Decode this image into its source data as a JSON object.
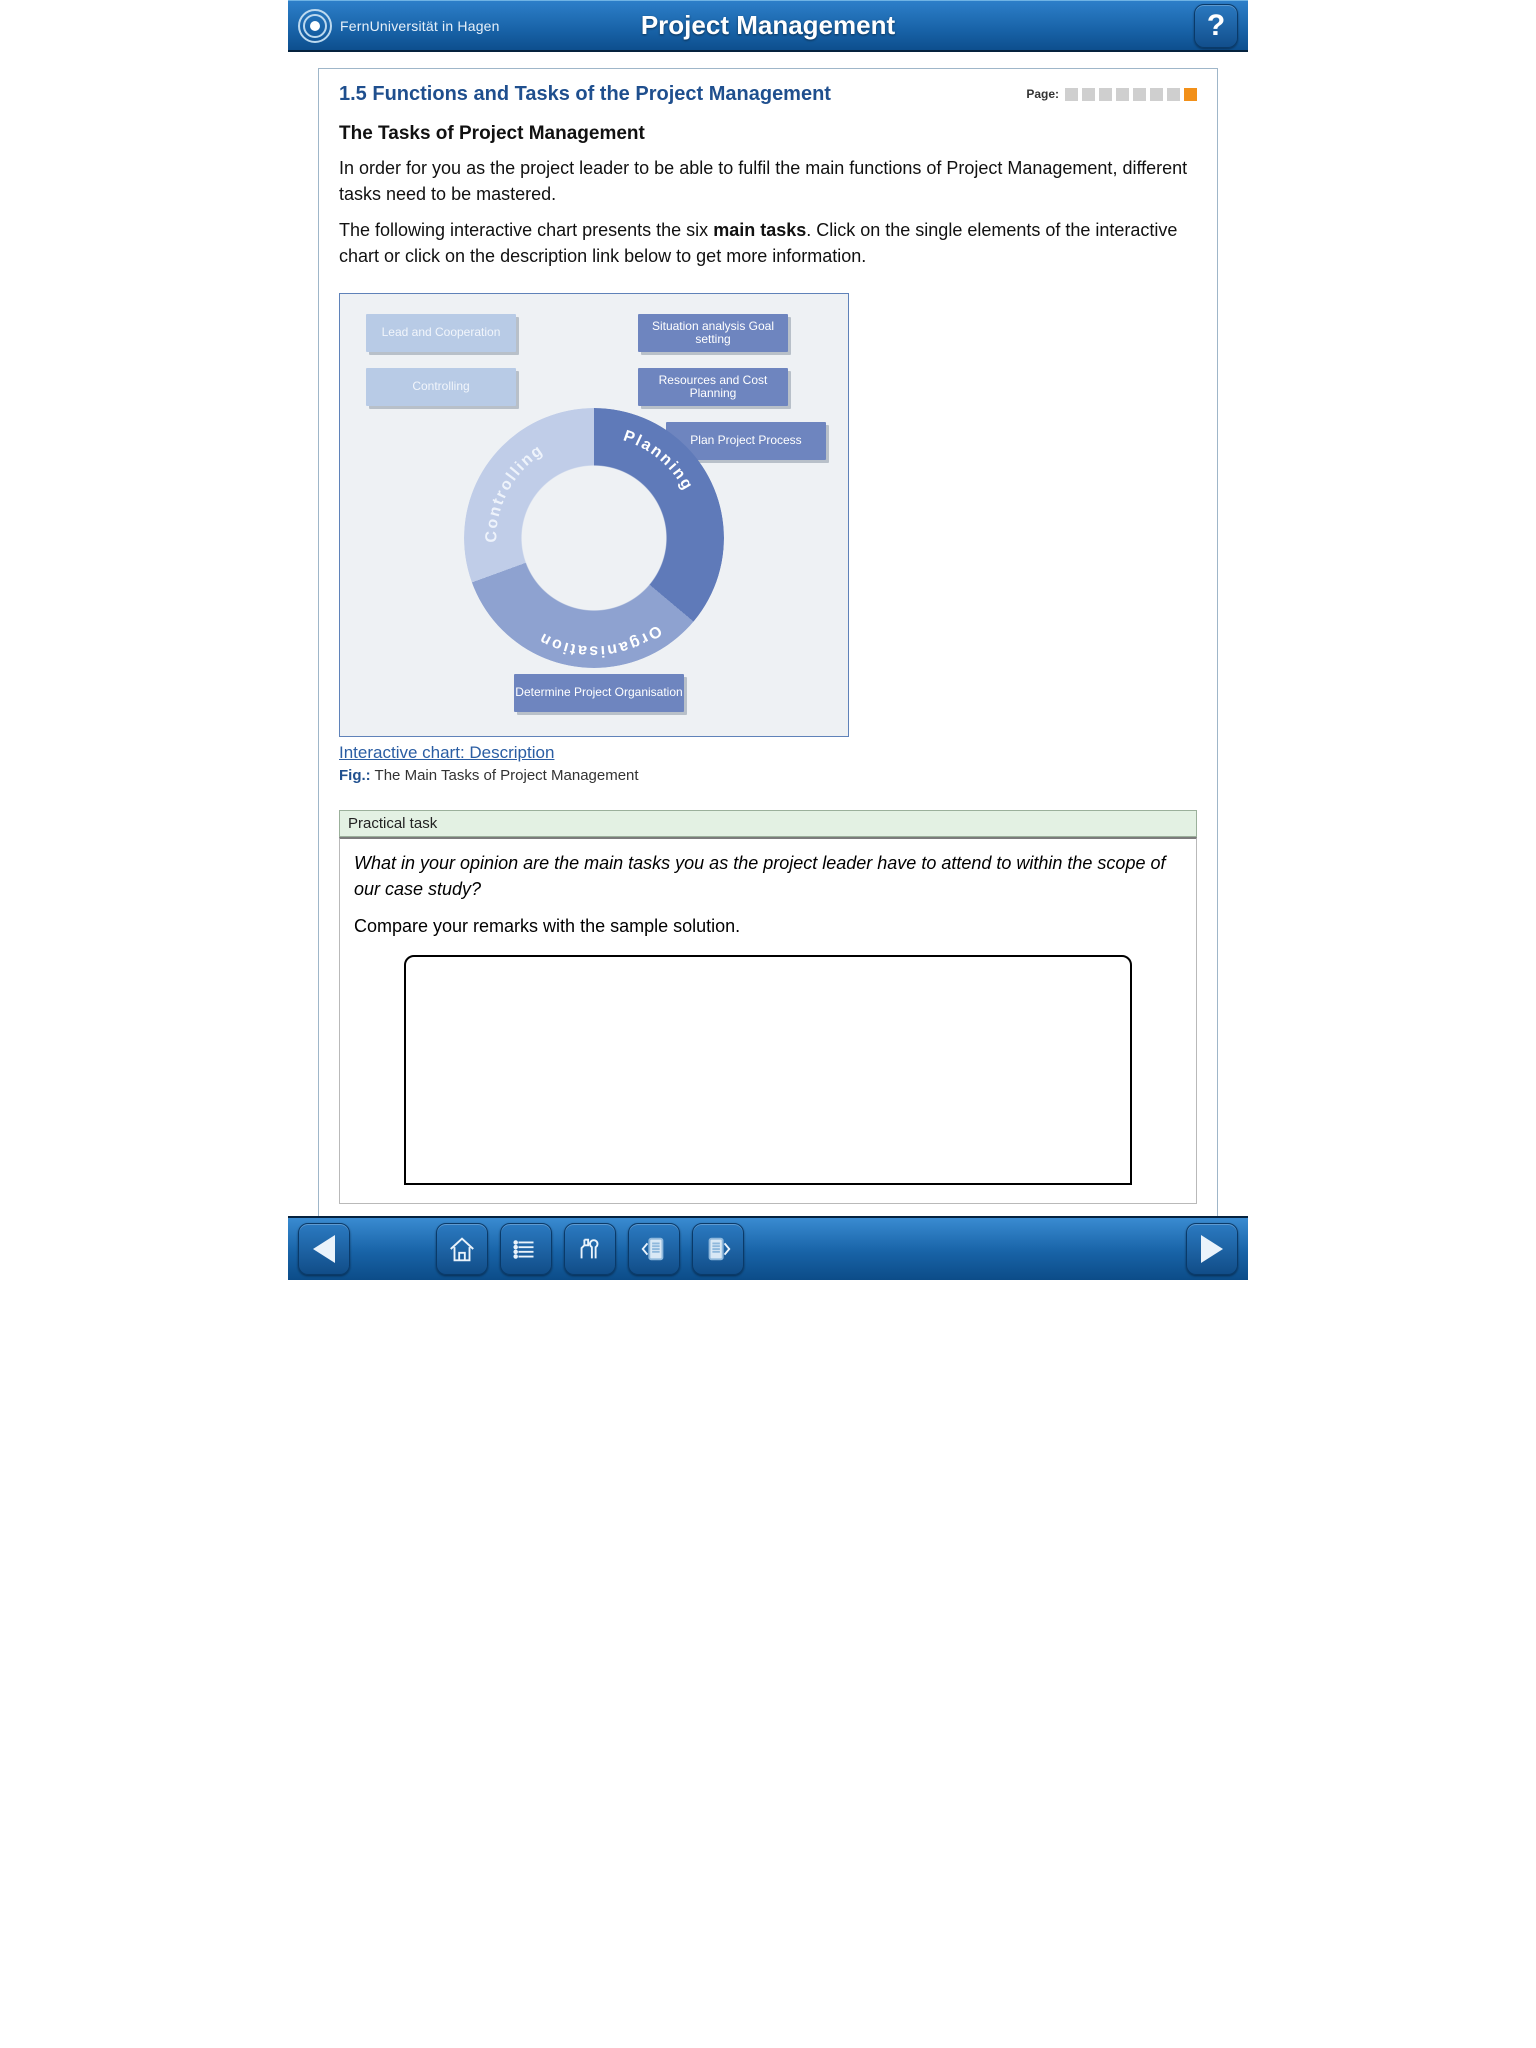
{
  "header": {
    "institution": "FernUniversität in Hagen",
    "course_title": "Project Management"
  },
  "page": {
    "section_number": "1.5",
    "section_title": "Functions and Tasks of the Project Management",
    "pager_label": "Page:",
    "pager_total": 8,
    "pager_current": 8,
    "subheading": "The Tasks of Project Management",
    "para1": "In order for you as the project leader to be able to fulfil the main functions of Project Management, different tasks need to be mastered.",
    "para2_a": "The following interactive chart presents the six ",
    "para2_bold": "main tasks",
    "para2_b": ". Click on the single elements of the interactive chart or click on the description link below to get more information."
  },
  "chart": {
    "buttons": {
      "lead": "Lead and Cooperation",
      "controlling": "Controlling",
      "situation": "Situation analysis Goal setting",
      "resources": "Resources and Cost Planning",
      "process": "Plan Project Process",
      "determine": "Determine Project Organisation"
    },
    "ring": {
      "planning": "Planning",
      "organisation": "Organisation",
      "controlling": "Controlling"
    },
    "link_text": "Interactive chart: Description",
    "caption_prefix": "Fig.:",
    "caption_text": " The Main Tasks of Project Management"
  },
  "task": {
    "header": "Practical task",
    "question": "What in your opinion are the main tasks you as the project leader have to attend to within the scope of our case study?",
    "instruction": "Compare your remarks with the sample solution."
  },
  "toolbar": {
    "prev": "Previous page",
    "home": "Home",
    "contents": "Contents",
    "tools": "Tools",
    "notes_prev": "Previous note",
    "notes_next": "Next note",
    "next": "Next page"
  }
}
